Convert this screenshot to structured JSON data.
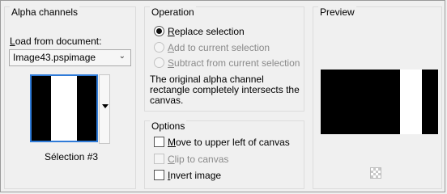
{
  "alpha": {
    "title": "Alpha channels",
    "load_label": "Load from document:",
    "document_value": "Image43.pspimage",
    "selection_caption": "Sélection #3"
  },
  "operation": {
    "title": "Operation",
    "options": [
      {
        "label": "Replace selection",
        "selected": true,
        "enabled": true
      },
      {
        "label": "Add to current selection",
        "selected": false,
        "enabled": false
      },
      {
        "label": "Subtract from current selection",
        "selected": false,
        "enabled": false
      }
    ],
    "message": "The original alpha channel rectangle completely intersects the canvas."
  },
  "options": {
    "title": "Options",
    "items": [
      {
        "label": "Move to upper left of canvas",
        "checked": false,
        "enabled": true
      },
      {
        "label": "Clip to canvas",
        "checked": false,
        "enabled": false
      },
      {
        "label": "Invert image",
        "checked": false,
        "enabled": true
      }
    ]
  },
  "preview": {
    "title": "Preview"
  },
  "colors": {
    "focus": "#2f7bd8",
    "black": "#000000",
    "white": "#ffffff"
  }
}
